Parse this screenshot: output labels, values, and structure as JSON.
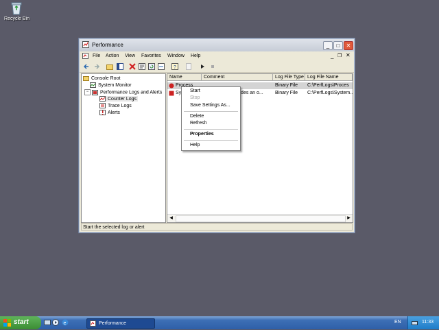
{
  "desktop": {
    "recycle_label": "Recycle Bin"
  },
  "window": {
    "title": "Performance",
    "menus": [
      "File",
      "Action",
      "View",
      "Favorites",
      "Window",
      "Help"
    ],
    "tree": {
      "console_root": "Console Root",
      "system_monitor": "System Monitor",
      "perf_logs": "Performance Logs and Alerts",
      "counter_logs": "Counter Logs",
      "trace_logs": "Trace Logs",
      "alerts": "Alerts"
    },
    "columns": [
      "Name",
      "Comment",
      "Log File Type",
      "Log File Name"
    ],
    "rows": [
      {
        "name": "Process",
        "comment": "",
        "type": "Binary File",
        "file": "C:\\PerfLogs\\Proces"
      },
      {
        "name": "System",
        "comment": "vides an o...",
        "type": "Binary File",
        "file": "C:\\PerfLogs\\System..."
      }
    ],
    "status": "Start the selected log or alert"
  },
  "context_menu": {
    "start": "Start",
    "stop": "Stop",
    "save_settings": "Save Settings As...",
    "delete": "Delete",
    "refresh": "Refresh",
    "properties": "Properties",
    "help": "Help"
  },
  "taskbar": {
    "start_label": "start",
    "task_label": "Performance",
    "lang": "EN",
    "clock": "11:33"
  },
  "colors": {
    "accent": "#316ac5",
    "taskbar_blue": "#2e5fa8",
    "start_green": "#3b8d34"
  }
}
